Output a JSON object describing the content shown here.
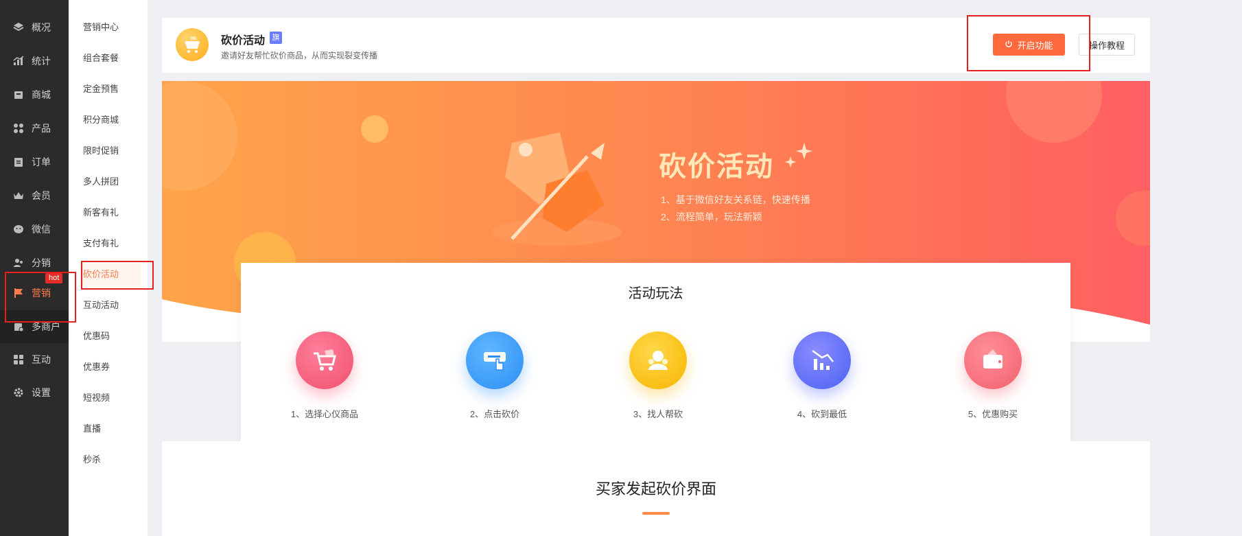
{
  "sidebar": {
    "items": [
      {
        "label": "概况",
        "icon": "layers-icon"
      },
      {
        "label": "统计",
        "icon": "chart-icon"
      },
      {
        "label": "商城",
        "icon": "shop-icon"
      },
      {
        "label": "产品",
        "icon": "grid-icon"
      },
      {
        "label": "订单",
        "icon": "order-icon"
      },
      {
        "label": "会员",
        "icon": "crown-icon"
      },
      {
        "label": "微信",
        "icon": "wechat-icon"
      },
      {
        "label": "分销",
        "icon": "users-icon"
      },
      {
        "label": "营销",
        "icon": "flag-icon"
      },
      {
        "label": "多商户",
        "icon": "gear-shop-icon"
      },
      {
        "label": "互动",
        "icon": "grid2-icon"
      },
      {
        "label": "设置",
        "icon": "gear-icon"
      }
    ],
    "hot_badge": "hot"
  },
  "submenu": {
    "items": [
      "营销中心",
      "组合套餐",
      "定金预售",
      "积分商城",
      "限时促销",
      "多人拼团",
      "新客有礼",
      "支付有礼",
      "砍价活动",
      "互动活动",
      "优惠码",
      "优惠券",
      "短视频",
      "直播",
      "秒杀"
    ]
  },
  "header": {
    "title": "砍价活动",
    "badge": "旗",
    "subtitle": "邀请好友帮忙砍价商品，从而实现裂变传播",
    "enable_button": "开启功能",
    "tutorial_button": "操作教程"
  },
  "banner": {
    "title": "砍价活动",
    "lines": [
      "1、基于微信好友关系链，快速传播",
      "2、流程简单，玩法新颖"
    ]
  },
  "rules": {
    "title": "活动玩法",
    "steps": [
      {
        "label": "1、选择心仪商品",
        "icon": "cart-icon"
      },
      {
        "label": "2、点击砍价",
        "icon": "tap-icon"
      },
      {
        "label": "3、找人帮砍",
        "icon": "people-icon"
      },
      {
        "label": "4、砍到最低",
        "icon": "trend-down-icon"
      },
      {
        "label": "5、优惠购买",
        "icon": "wallet-icon"
      }
    ]
  },
  "lower": {
    "title": "买家发起砍价界面"
  },
  "colors": {
    "accent": "#ff6a3c",
    "sidebar": "#2b2b2b",
    "badge": "#6a7cff"
  }
}
